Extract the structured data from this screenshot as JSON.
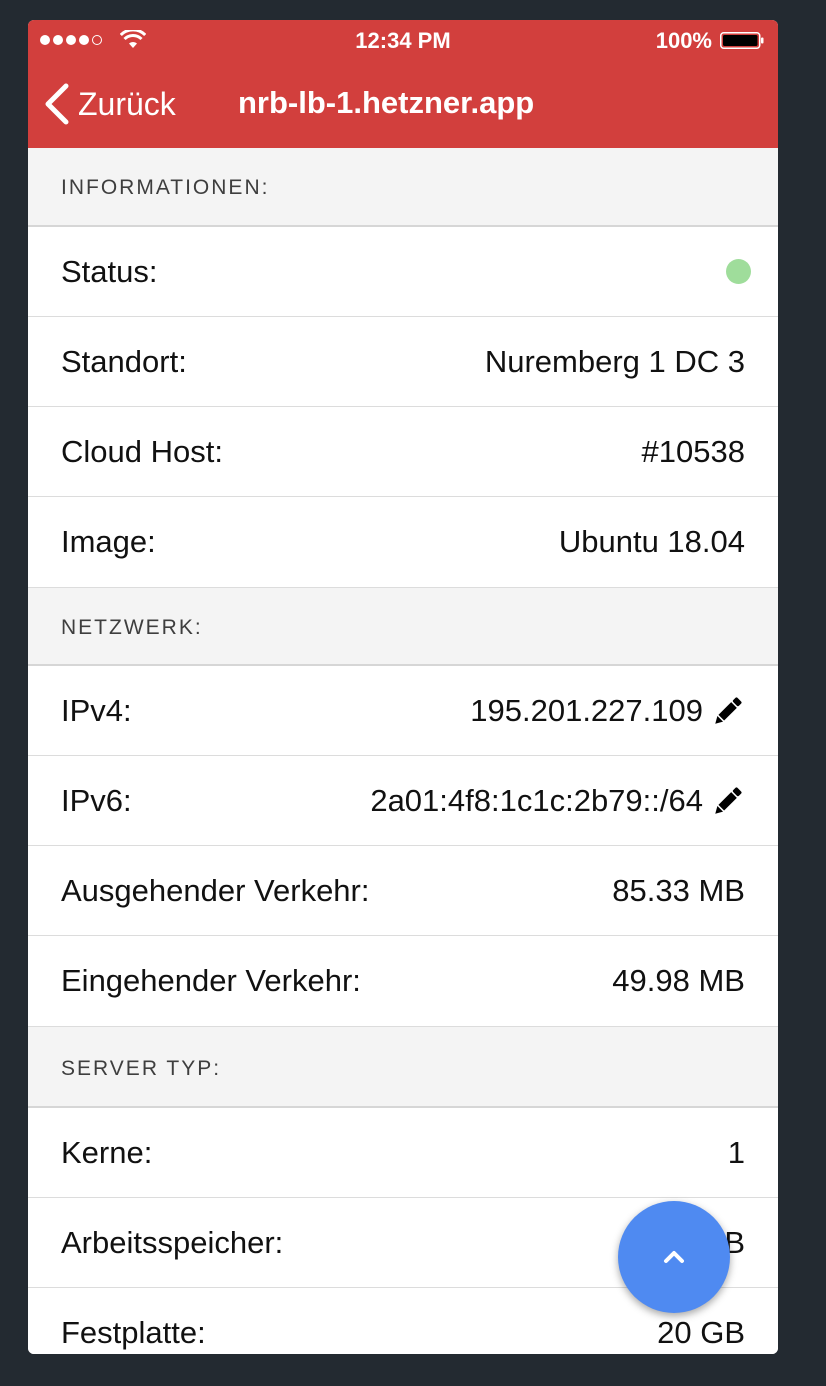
{
  "status_bar": {
    "time": "12:34 PM",
    "battery": "100%"
  },
  "nav": {
    "back_label": "Zurück",
    "title": "nrb-lb-1.hetzner.app"
  },
  "sections": {
    "info": {
      "header": "INFORMATIONEN:",
      "status_label": "Status:",
      "location_label": "Standort:",
      "location_value": "Nuremberg 1 DC 3",
      "host_label": "Cloud Host:",
      "host_value": "#10538",
      "image_label": "Image:",
      "image_value": "Ubuntu 18.04"
    },
    "network": {
      "header": "NETZWERK:",
      "ipv4_label": "IPv4:",
      "ipv4_value": "195.201.227.109",
      "ipv6_label": "IPv6:",
      "ipv6_value": "2a01:4f8:1c1c:2b79::/64",
      "out_label": "Ausgehender Verkehr:",
      "out_value": "85.33 MB",
      "in_label": "Eingehender Verkehr:",
      "in_value": "49.98 MB"
    },
    "server_type": {
      "header": "SERVER TYP:",
      "cores_label": "Kerne:",
      "cores_value": "1",
      "memory_label": "Arbeitsspeicher:",
      "memory_value": "2048 MB",
      "disk_label": "Festplatte:",
      "disk_value": "20 GB"
    }
  },
  "colors": {
    "header_red": "#d23f3d",
    "status_online": "#9fdd9b",
    "fab_blue": "#4f8af1"
  },
  "icons": {
    "back": "chevron-left-icon",
    "edit": "pencil-icon",
    "scroll_top": "chevron-up-icon"
  }
}
